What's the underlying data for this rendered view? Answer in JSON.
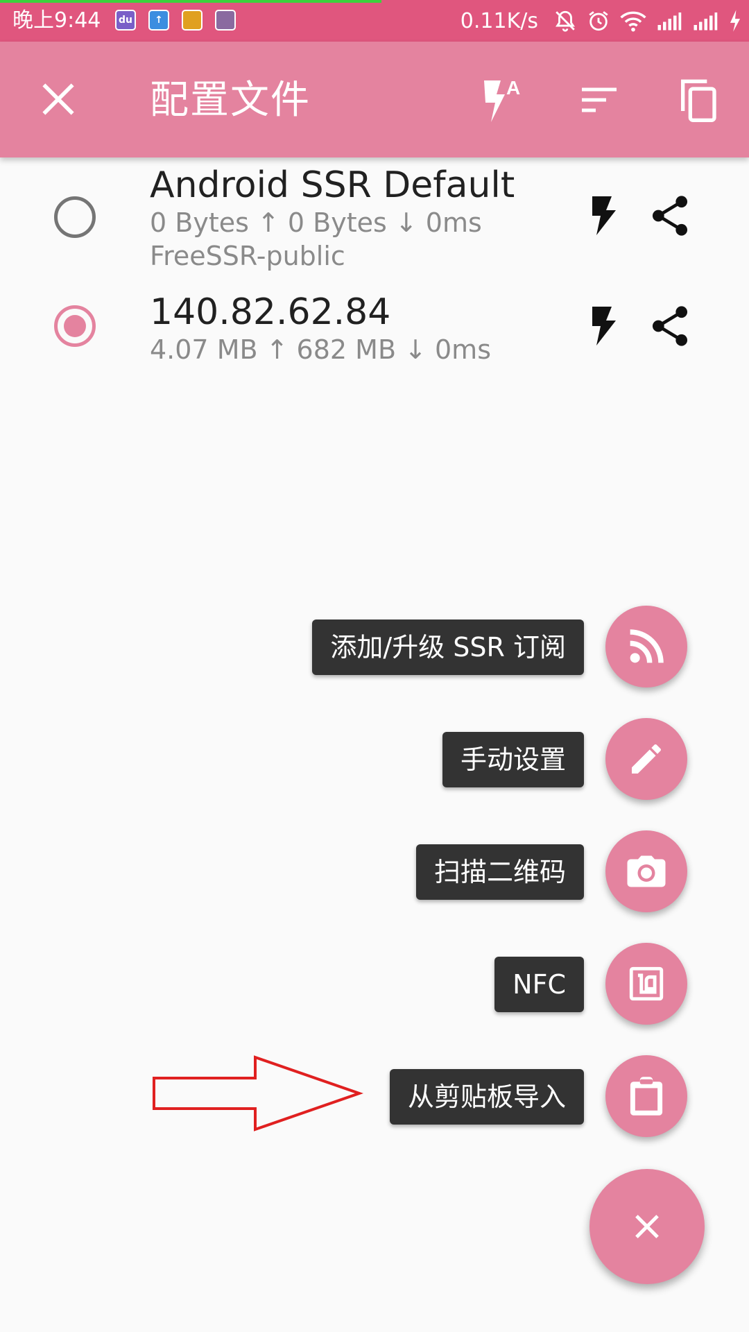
{
  "status_bar": {
    "time": "晚上9:44",
    "net_speed": "0.11K/s",
    "app_icons": [
      {
        "name": "du-app-icon",
        "label": "du",
        "color": "#7a5fc8"
      },
      {
        "name": "upload-app-icon",
        "label": "↑",
        "color": "#3c8ee0"
      },
      {
        "name": "game-app-icon",
        "label": "",
        "color": "#e0a020"
      },
      {
        "name": "calendar-app-icon",
        "label": "",
        "color": "#8a6aa0"
      }
    ]
  },
  "app_bar": {
    "title": "配置文件",
    "close_icon": "close-icon",
    "actions": [
      "flash-auto-icon",
      "sort-icon",
      "copy-icon"
    ]
  },
  "profiles": [
    {
      "name": "Android SSR Default",
      "stats": "0 Bytes ↑   0 Bytes ↓   0ms",
      "group": "FreeSSR-public",
      "selected": false
    },
    {
      "name": "140.82.62.84",
      "stats": "4.07 MB ↑ 682 MB ↓   0ms",
      "group": "",
      "selected": true
    }
  ],
  "fab_menu": {
    "items": [
      {
        "label": "添加/升级 SSR 订阅",
        "icon": "rss-icon"
      },
      {
        "label": "手动设置",
        "icon": "pencil-icon"
      },
      {
        "label": "扫描二维码",
        "icon": "camera-icon"
      },
      {
        "label": "NFC",
        "icon": "nfc-icon"
      },
      {
        "label": "从剪贴板导入",
        "icon": "clipboard-icon"
      }
    ],
    "main_icon": "close-icon"
  },
  "colors": {
    "status_bar": "#e0567e",
    "app_bar": "#e4839f",
    "accent": "#e4839f",
    "label_bg": "#333333",
    "annotation": "#e02020"
  }
}
